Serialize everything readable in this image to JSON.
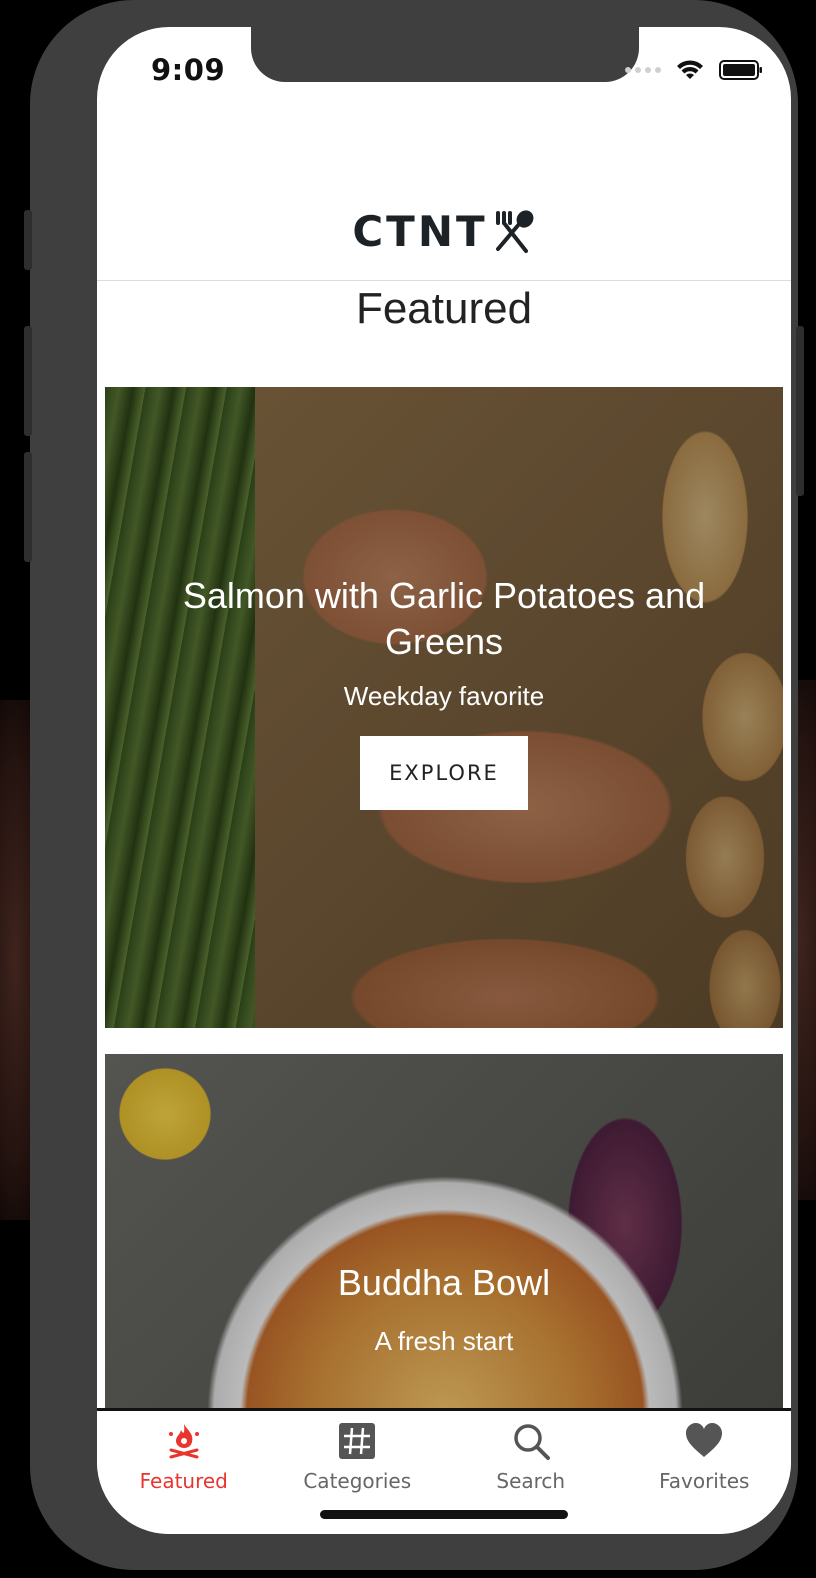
{
  "status_bar": {
    "time": "9:09"
  },
  "header": {
    "logo_text": "CTNT"
  },
  "featured": {
    "title": "Featured",
    "cards": [
      {
        "title": "Salmon with Garlic Potatoes and Greens",
        "subtitle": "Weekday favorite",
        "button": "EXPLORE"
      },
      {
        "title": "Buddha Bowl",
        "subtitle": "A fresh start"
      }
    ]
  },
  "tabs": [
    {
      "label": "Featured",
      "icon": "campfire-icon",
      "active": true
    },
    {
      "label": "Categories",
      "icon": "grid-icon",
      "active": false
    },
    {
      "label": "Search",
      "icon": "search-icon",
      "active": false
    },
    {
      "label": "Favorites",
      "icon": "heart-icon",
      "active": false
    }
  ],
  "colors": {
    "accent": "#e8352e",
    "tab_inactive": "#666666",
    "logo": "#1d2226"
  }
}
